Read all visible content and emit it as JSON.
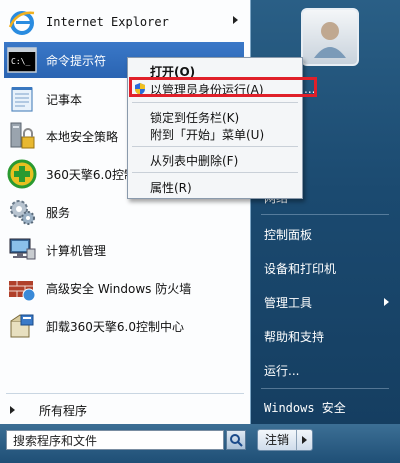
{
  "left_items": [
    {
      "label": "Internet Explorer",
      "icon": "ie-icon",
      "has_arrow": true,
      "mono": true
    },
    {
      "label": "命令提示符",
      "icon": "cmd-icon",
      "has_arrow": false,
      "selected": true
    },
    {
      "label": "记事本",
      "icon": "notepad-icon",
      "has_arrow": false
    },
    {
      "label": "本地安全策略",
      "icon": "security-policy-icon",
      "has_arrow": false
    },
    {
      "label": "360天擎6.0控制",
      "icon": "360-icon",
      "has_arrow": false
    },
    {
      "label": "服务",
      "icon": "services-icon",
      "has_arrow": false
    },
    {
      "label": "计算机管理",
      "icon": "computer-management-icon",
      "has_arrow": false
    },
    {
      "label": "高级安全 Windows 防火墙",
      "icon": "firewall-icon",
      "has_arrow": false
    },
    {
      "label": "卸载360天擎6.0控制中心",
      "icon": "uninstall-icon",
      "has_arrow": false
    }
  ],
  "all_programs": "所有程序",
  "right_links": [
    {
      "label": "网络",
      "has_arrow": false
    },
    {
      "label": "控制面板",
      "has_arrow": false
    },
    {
      "label": "设备和打印机",
      "has_arrow": false
    },
    {
      "label": "管理工具",
      "has_arrow": true
    },
    {
      "label": "帮助和支持",
      "has_arrow": false
    },
    {
      "label": "运行...",
      "has_arrow": false
    },
    {
      "label": "Windows 安全",
      "has_arrow": false
    }
  ],
  "search": {
    "placeholder": "搜索程序和文件"
  },
  "shutdown": {
    "label": "注销"
  },
  "context_menu": {
    "open": "打开(O)",
    "run_as_admin": "以管理员身份运行(A)",
    "pin_taskbar": "锁定到任务栏(K)",
    "pin_start": "附到「开始」菜单(U)",
    "remove": "从列表中删除(F)",
    "properties": "属性(R)"
  },
  "cut_text": "..."
}
